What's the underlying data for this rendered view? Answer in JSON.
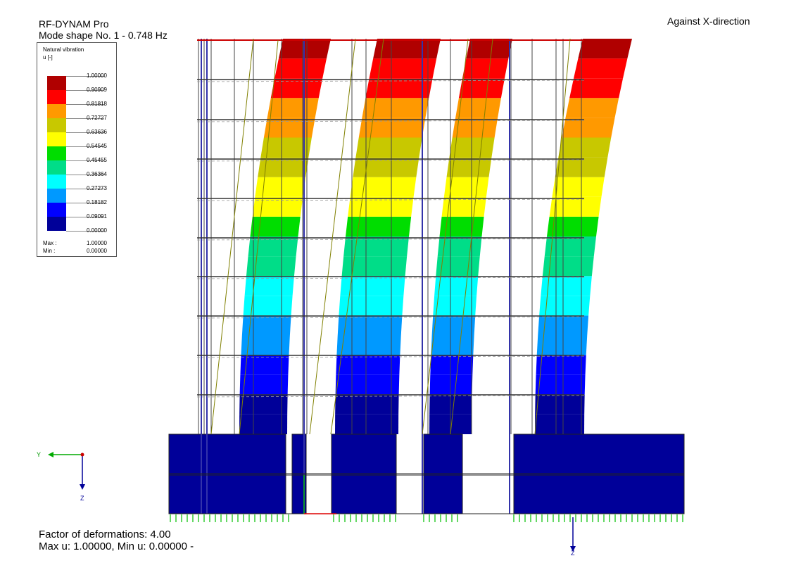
{
  "header": {
    "program": "RF-DYNAM Pro",
    "mode_shape": "Mode shape No. 1 - 0.748 Hz",
    "direction": "Against X-direction"
  },
  "legend": {
    "title": "Natural vibration",
    "unit": "u [-]",
    "entries": [
      {
        "value": "1.00000",
        "color": "#b00000"
      },
      {
        "value": "0.90909",
        "color": "#ff0000"
      },
      {
        "value": "0.81818",
        "color": "#ff9900"
      },
      {
        "value": "0.72727",
        "color": "#c8c800"
      },
      {
        "value": "0.63636",
        "color": "#ffff00"
      },
      {
        "value": "0.54545",
        "color": "#00dd00"
      },
      {
        "value": "0.45455",
        "color": "#00dd88"
      },
      {
        "value": "0.36364",
        "color": "#00ffff"
      },
      {
        "value": "0.27273",
        "color": "#0099ff"
      },
      {
        "value": "0.18182",
        "color": "#0000ff"
      },
      {
        "value": "0.09091",
        "color": "#000099"
      }
    ],
    "last_value": "0.00000",
    "max_label": "Max :",
    "max_value": "1.00000",
    "min_label": "Min :",
    "min_value": "0.00000"
  },
  "footer": {
    "factor": "Factor of deformations: 4.00",
    "range": "Max u: 1.00000, Min u: 0.00000 -"
  },
  "axes": {
    "y_label": "Y",
    "z_label": "Z",
    "z2_label": "Z"
  }
}
